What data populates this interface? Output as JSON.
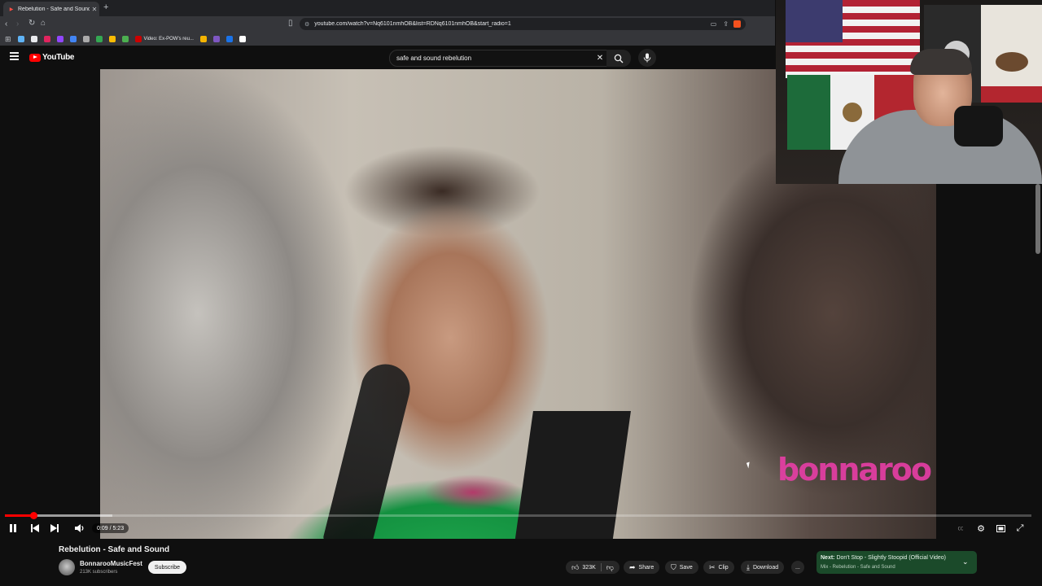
{
  "browser": {
    "tab_title": "Rebelution - Safe and Sound",
    "tab_audio_icon": "speaker-icon",
    "new_tab_label": "+",
    "url": "youtube.com/watch?v=Nq6101nmhOB&list=RDNq6101nmhOB&start_radio=1",
    "bookmarks": [
      {
        "label": "",
        "color": "#5fb3f5"
      },
      {
        "label": "",
        "color": "#e8eaed"
      },
      {
        "label": "",
        "color": "#e0245e"
      },
      {
        "label": "",
        "color": "#9146ff"
      },
      {
        "label": "",
        "color": "#4285f4"
      },
      {
        "label": "",
        "color": "#aaaaaa"
      },
      {
        "label": "",
        "color": "#34a853"
      },
      {
        "label": "",
        "color": "#fbbc04"
      },
      {
        "label": "",
        "color": "#4caf50"
      },
      {
        "label": "Video: Ex-POW's reu...",
        "color": "#cc0000"
      },
      {
        "label": "",
        "color": "#f4b400"
      },
      {
        "label": "",
        "color": "#7e57c2"
      },
      {
        "label": "",
        "color": "#1a73e8"
      },
      {
        "label": "",
        "color": "#ffffff"
      }
    ]
  },
  "youtube": {
    "logo_text": "YouTube",
    "search_query": "safe and sound rebelution"
  },
  "player": {
    "time_display": "0:09 / 5:23",
    "progress_fraction": 0.028,
    "loaded_fraction": 0.105,
    "watermark": "bonnaroo"
  },
  "video_info": {
    "title": "Rebelution - Safe and Sound",
    "channel": "BonnarooMusicFest",
    "subscribers": "213K subscribers",
    "subscribe_label": "Subscribe",
    "likes": "323K",
    "share_label": "Share",
    "save_label": "Save",
    "clip_label": "Clip",
    "download_label": "Download",
    "more_label": "..."
  },
  "next_card": {
    "next_prefix": "Next:",
    "next_title": "Don't Stop - Slightly Stoopid (Official Video)",
    "mix_label": "Mix - Rebelution - Safe and Sound"
  },
  "colors": {
    "accent": "#ff0000",
    "next_card_bg": "#1b4a2a",
    "watermark": "#e83ea7"
  }
}
